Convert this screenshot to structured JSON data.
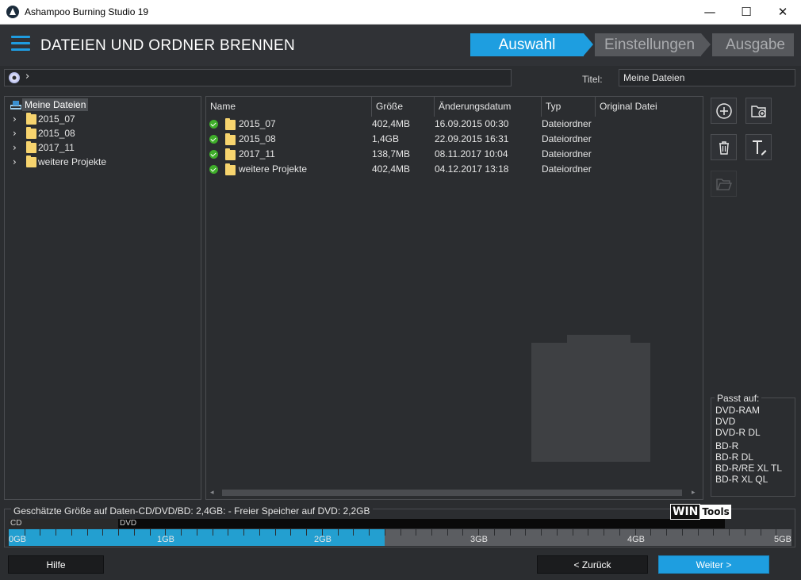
{
  "window": {
    "title": "Ashampoo Burning Studio 19",
    "minimize_glyph": "—",
    "maximize_glyph": "☐",
    "close_glyph": "✕"
  },
  "header": {
    "title": "DATEIEN UND ORDNER BRENNEN",
    "steps": [
      "Auswahl",
      "Einstellungen",
      "Ausgabe"
    ],
    "active_step": "Auswahl",
    "accent_color": "#1e9ee0"
  },
  "pathbar": {
    "chevron": "›",
    "disc_icon": "disc-icon"
  },
  "title_field": {
    "label": "Titel:",
    "value": "Meine Dateien"
  },
  "tree": {
    "root_label": "Meine Dateien",
    "expander_glyph": "›",
    "items": [
      "2015_07",
      "2015_08",
      "2017_11",
      "weitere Projekte"
    ]
  },
  "list": {
    "columns": [
      "Name",
      "Größe",
      "Änderungsdatum",
      "Typ",
      "Original Datei"
    ],
    "rows": [
      {
        "name": "2015_07",
        "size": "402,4MB",
        "date": "16.09.2015 00:30",
        "type": "Dateiordner",
        "original": ""
      },
      {
        "name": "2015_08",
        "size": "1,4GB",
        "date": "22.09.2015 16:31",
        "type": "Dateiordner",
        "original": ""
      },
      {
        "name": "2017_11",
        "size": "138,7MB",
        "date": "08.11.2017 10:04",
        "type": "Dateiordner",
        "original": ""
      },
      {
        "name": "weitere Projekte",
        "size": "402,4MB",
        "date": "04.12.2017 13:18",
        "type": "Dateiordner",
        "original": ""
      }
    ],
    "scroll_left_glyph": "◂",
    "scroll_right_glyph": "▸"
  },
  "actions": {
    "icons": [
      "add-icon",
      "add-folder-icon",
      "trash-icon",
      "rename-text-icon",
      "open-folder-icon"
    ]
  },
  "fits_on": {
    "title": "Passt auf:",
    "items": [
      "DVD-RAM",
      "DVD",
      "DVD-R DL",
      "BD-R",
      "BD-R DL",
      "BD-R/RE XL TL",
      "BD-R XL QL"
    ]
  },
  "capacity": {
    "label": "Geschätzte Größe auf Daten-CD/DVD/BD: 2,4GB: - Freier Speicher auf DVD: 2,2GB",
    "cd_label": "CD",
    "dvd_label": "DVD",
    "used_gb": 2.4,
    "max_gb": 5,
    "gb_ticks": [
      "0GB",
      "1GB",
      "2GB",
      "3GB",
      "4GB",
      "5GB"
    ]
  },
  "logo": {
    "win": "WIN",
    "tools": "Tools"
  },
  "buttons": {
    "help": "Hilfe",
    "back": "< Zurück",
    "next": "Weiter >"
  }
}
